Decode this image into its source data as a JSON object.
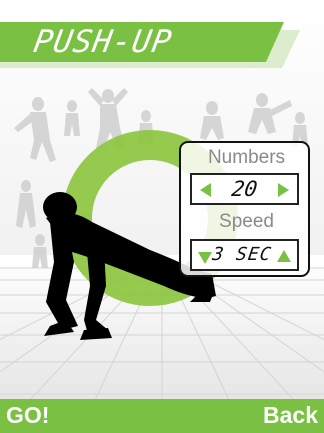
{
  "header": {
    "title": "PUSH-UP"
  },
  "settings": {
    "numbers_label": "Numbers",
    "numbers_value": "20",
    "speed_label": "Speed",
    "speed_value": "3 SEC"
  },
  "softkeys": {
    "left": "GO!",
    "right": "Back"
  },
  "icons": {
    "decrease_numbers": "arrow-left-icon",
    "increase_numbers": "arrow-right-icon",
    "decrease_speed": "arrow-down-icon",
    "increase_speed": "arrow-up-icon"
  },
  "colors": {
    "accent": "#7ac143",
    "panel_border": "#111111",
    "label_gray": "#8a8a8a",
    "silhouette": "#000000"
  }
}
